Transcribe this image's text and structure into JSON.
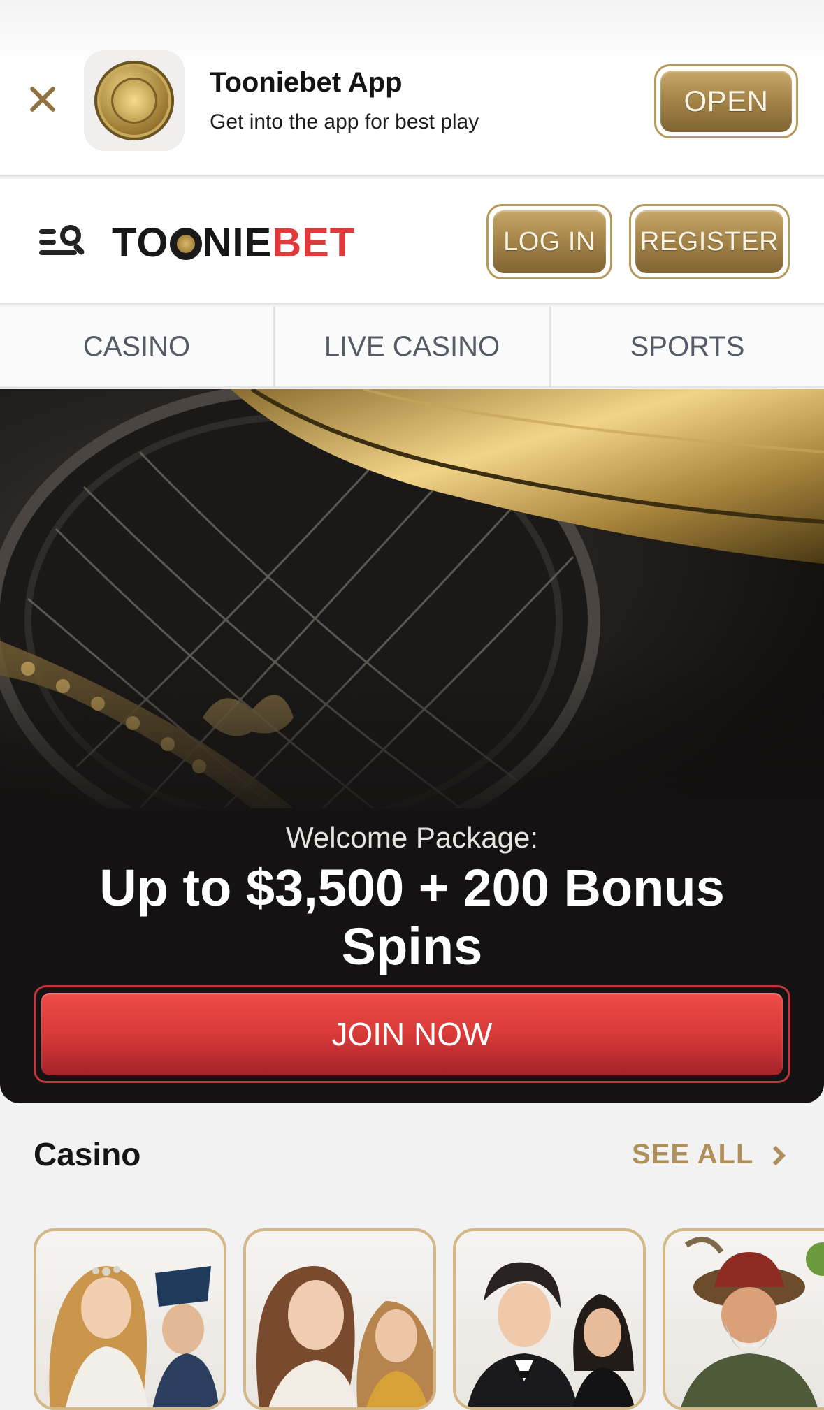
{
  "app_banner": {
    "title": "Tooniebet App",
    "subtitle": "Get into the app for best play",
    "open_label": "OPEN"
  },
  "header": {
    "logo_part1": "TO",
    "logo_part2": "NIE",
    "logo_part3": "BET",
    "login_label": "LOG IN",
    "register_label": "REGISTER"
  },
  "nav": {
    "tabs": [
      {
        "label": "CASINO"
      },
      {
        "label": "LIVE CASINO"
      },
      {
        "label": "SPORTS"
      }
    ]
  },
  "hero": {
    "kicker": "Welcome Package:",
    "title": "Up to $3,500 + 200 Bonus Spins",
    "join_label": "JOIN NOW"
  },
  "casino_section": {
    "title": "Casino",
    "see_all_label": "SEE ALL"
  },
  "colors": {
    "gold": "#b0905a",
    "red": "#e03a3a",
    "hero_bg": "#141212"
  }
}
